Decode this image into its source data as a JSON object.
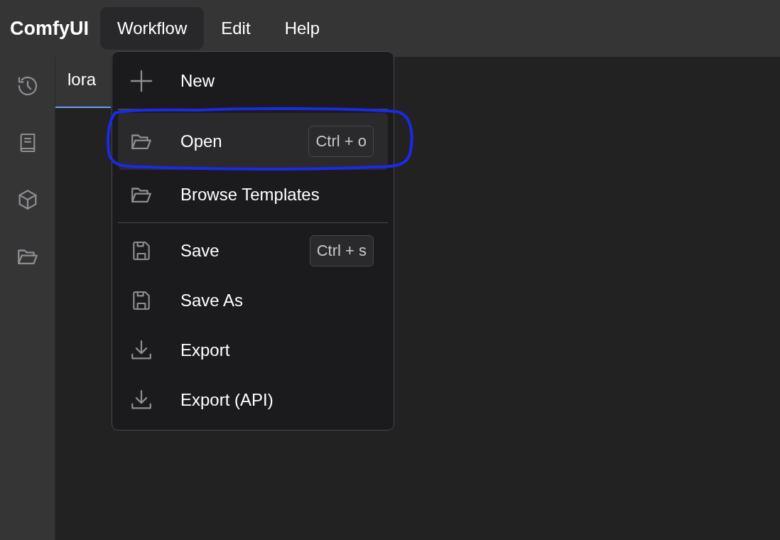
{
  "app": {
    "logo": "ComfyUI"
  },
  "menubar": [
    {
      "label": "Workflow",
      "expanded": true
    },
    {
      "label": "Edit",
      "expanded": false
    },
    {
      "label": "Help",
      "expanded": false
    }
  ],
  "sidebar": {
    "items": [
      {
        "kind": "history"
      },
      {
        "kind": "book"
      },
      {
        "kind": "cube"
      },
      {
        "kind": "folder"
      }
    ]
  },
  "tabs": [
    {
      "label": "lora",
      "selected": true
    }
  ],
  "workflow_menu": {
    "entries": [
      {
        "kind": "item",
        "label": "New",
        "selected": false,
        "circled": false
      },
      {
        "kind": "divider"
      },
      {
        "kind": "item",
        "label": "Open",
        "shortcut": "Ctrl + o",
        "selected": true,
        "circled": true
      },
      {
        "kind": "item",
        "label": "Browse Templates",
        "selected": false,
        "circled": false
      },
      {
        "kind": "divider"
      },
      {
        "kind": "item",
        "label": "Save",
        "shortcut": "Ctrl + s",
        "selected": false,
        "circled": false
      },
      {
        "kind": "item",
        "label": "Save As",
        "selected": false,
        "circled": false
      },
      {
        "kind": "item",
        "label": "Export",
        "selected": false,
        "circled": false
      },
      {
        "kind": "item",
        "label": "Export (API)",
        "selected": false,
        "circled": false
      }
    ]
  }
}
